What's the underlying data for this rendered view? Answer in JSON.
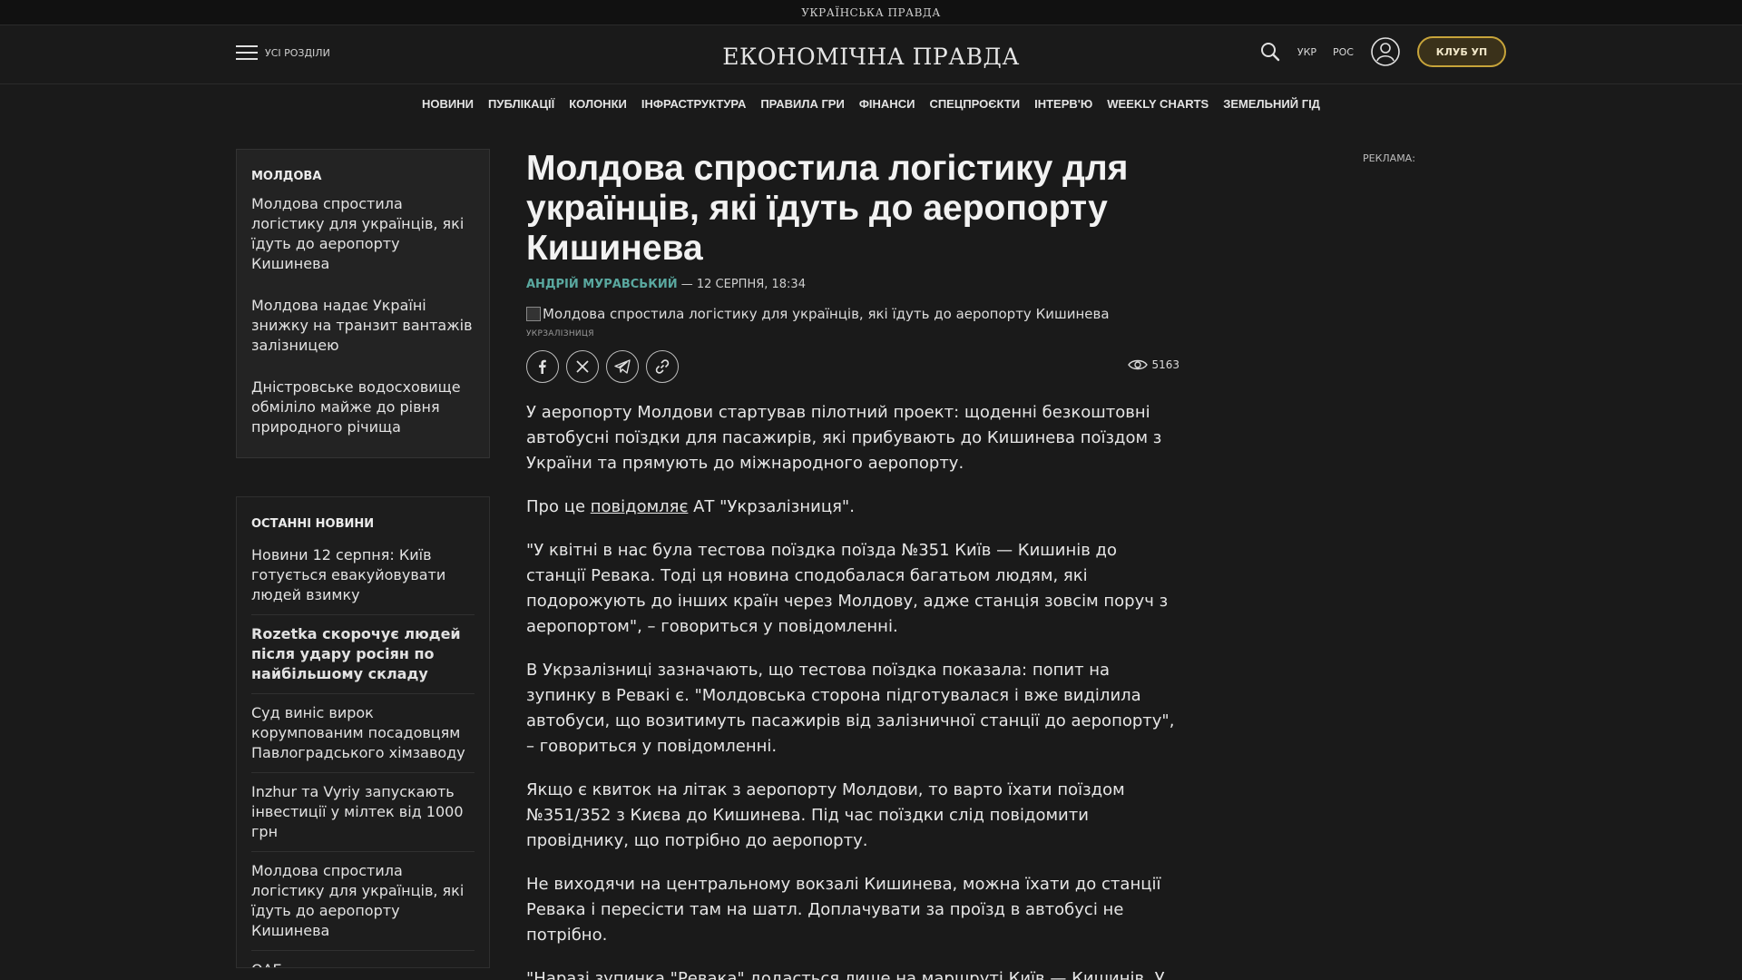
{
  "topbar": {
    "brand": "УКРАЇНСЬКА ПРАВДА"
  },
  "header": {
    "menu_label": "УСІ РОЗДІЛИ",
    "logo": "ЕКОНОМІЧНА ПРАВДА",
    "lang_ukr": "УКР",
    "lang_ros": "РОС",
    "club_label": "КЛУБ УП"
  },
  "nav": [
    "НОВИНИ",
    "ПУБЛІКАЦІЇ",
    "КОЛОНКИ",
    "ІНФРАСТРУКТУРА",
    "ПРАВИЛА ГРИ",
    "ФІНАНСИ",
    "СПЕЦПРОЄКТИ",
    "ІНТЕРВ'Ю",
    "WEEKLY CHARTS",
    "ЗЕМЕЛЬНИЙ ГІД"
  ],
  "sidebar_topic": {
    "title": "МОЛДОВА",
    "items": [
      "Молдова спростила логістику для українців, які їдуть до аеропорту Кишинева",
      "Молдова надає Україні знижку на транзит вантажів залізницею",
      "Дністровське водосховище обміліло майже до рівня природного річища"
    ]
  },
  "latest_news": {
    "title": "ОСТАННІ НОВИНИ",
    "items": [
      "Новини 12 серпня: Київ готується евакуйовувати людей взимку",
      "Rozetka скорочує людей після удару росіян по найбільшому складу",
      "Суд виніс вирок корумпованим посадовцям Павлоградського хімзаводу",
      "Inzhur та Vyriy запускають інвестиції у мілтек від 1000 грн",
      "Молдова спростила логістику для українців, які їдуть до аеропорту Кишинева",
      "ОАЕ..."
    ]
  },
  "article": {
    "title": "Молдова спростила логістику для українців, які їдуть до аеропорту Кишинева",
    "author": "АНДРІЙ МУРАВСЬКИЙ",
    "date": " — 12 СЕРПНЯ, 18:34",
    "image_alt": "Молдова спростила логістику для українців, які їдуть до аеропорту Кишинева",
    "image_caption": "УКРЗАЛІЗНИЦЯ",
    "views": "5163",
    "p1": "У аеропорту Молдови стартував пілотний проект: щоденні безкоштовні автобусні поїздки для пасажирів, які прибувають до Кишинева поїздом з України та прямують до міжнародного аеропорту.",
    "p2_before": "Про це ",
    "p2_link": "повідомляє",
    "p2_after": " АТ \"Укрзалізниця\".",
    "p3": "\"У квітні в нас була тестова поїздка поїзда №351 Київ — Кишинів до станції Ревака. Тоді ця новина сподобалася багатьом людям, які подорожують до інших країн через Молдову, адже станція зовсім поруч з аеропортом\", – говориться у повідомленні.",
    "p4": "В Укрзалізниці зазначають, що тестова поїздка показала: попит на зупинку в Ревакі є. \"Молдовська сторона підготувалася і вже виділила автобуси, що возитимуть пасажирів від залізничної станції до аеропорту\", – говориться у повідомленні.",
    "p5": "Якщо є квиток на літак з аеропорту Молдови, то варто їхати поїздом №351/352 з Києва до Кишинева. Під час поїздки слід повідомити провіднику, що потрібно до аеропорту.",
    "p6": "Не виходячи на центральному вокзалі Кишинева, можна їхати до станції Ревака і пересісти там на шатл. Доплачувати за проїзд в автобусі не потрібно.",
    "p7": "\"Наразі зупинка \"Ревака\" додасться лише на маршруті Київ — Кишинів. У"
  },
  "ad_label": "РЕКЛАМА:"
}
